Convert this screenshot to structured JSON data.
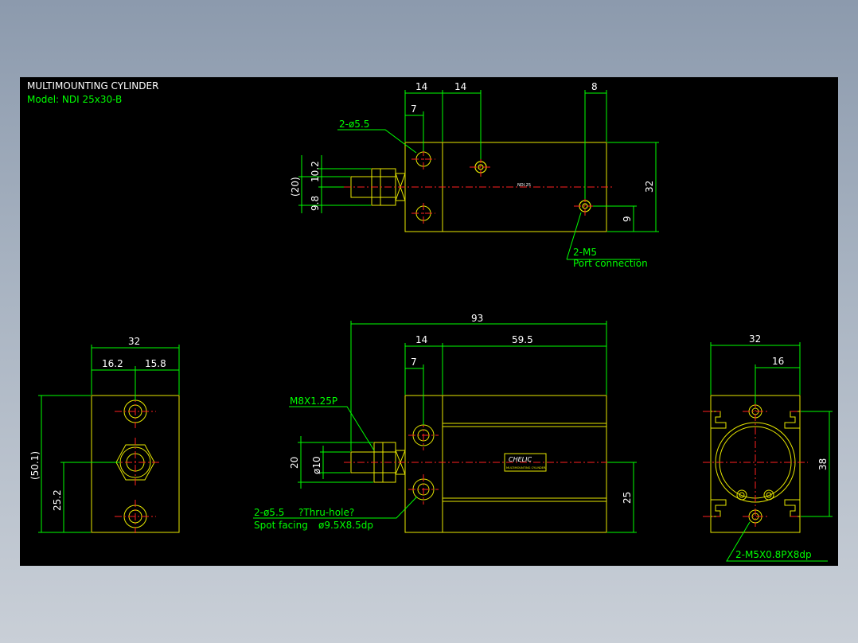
{
  "title": {
    "line1": "MULTIMOUNTING CYLINDER",
    "line2": "Model: NDI 25x30-B"
  },
  "top_view": {
    "dims": {
      "d14_a": "14",
      "d14_b": "14",
      "d7": "7",
      "d8": "8",
      "d32": "32",
      "d20": "(20)",
      "d10_2": "10.2",
      "d9_8": "9.8",
      "d9": "9"
    },
    "callout_hole": "2-ø5.5",
    "callout_port": "2-M5",
    "callout_port_sub": "Port connection",
    "body_marking": "NDI.25"
  },
  "front_view": {
    "dims": {
      "d93": "93",
      "d14": "14",
      "d59_5": "59.5",
      "d7": "7",
      "d20": "20",
      "d_rod": "ø10",
      "d25": "25"
    },
    "callout_thread": "M8X1.25P",
    "callout_hole": "2-ø5.5",
    "callout_hole_note": "?Thru-hole?",
    "callout_spot": "Spot facing",
    "callout_spot_size": "ø9.5X8.5dp",
    "label_brand": "CHELIC",
    "label_text": "MULTIMOUNTING CYLINDER"
  },
  "left_view": {
    "dims": {
      "d32": "32",
      "d16_2": "16.2",
      "d15_8": "15.8",
      "d50_1": "(50.1)",
      "d25_2": "25.2"
    }
  },
  "right_view": {
    "dims": {
      "d32": "32",
      "d16": "16",
      "d38": "38"
    },
    "callout_thread": "2-M5X0.8PX8dp"
  },
  "colors": {
    "background": "#000000",
    "outline": "#e8e800",
    "dimension": "#00ff00",
    "centerline": "#ff2020",
    "text": "#ffffff",
    "callout": "#00ff00"
  }
}
